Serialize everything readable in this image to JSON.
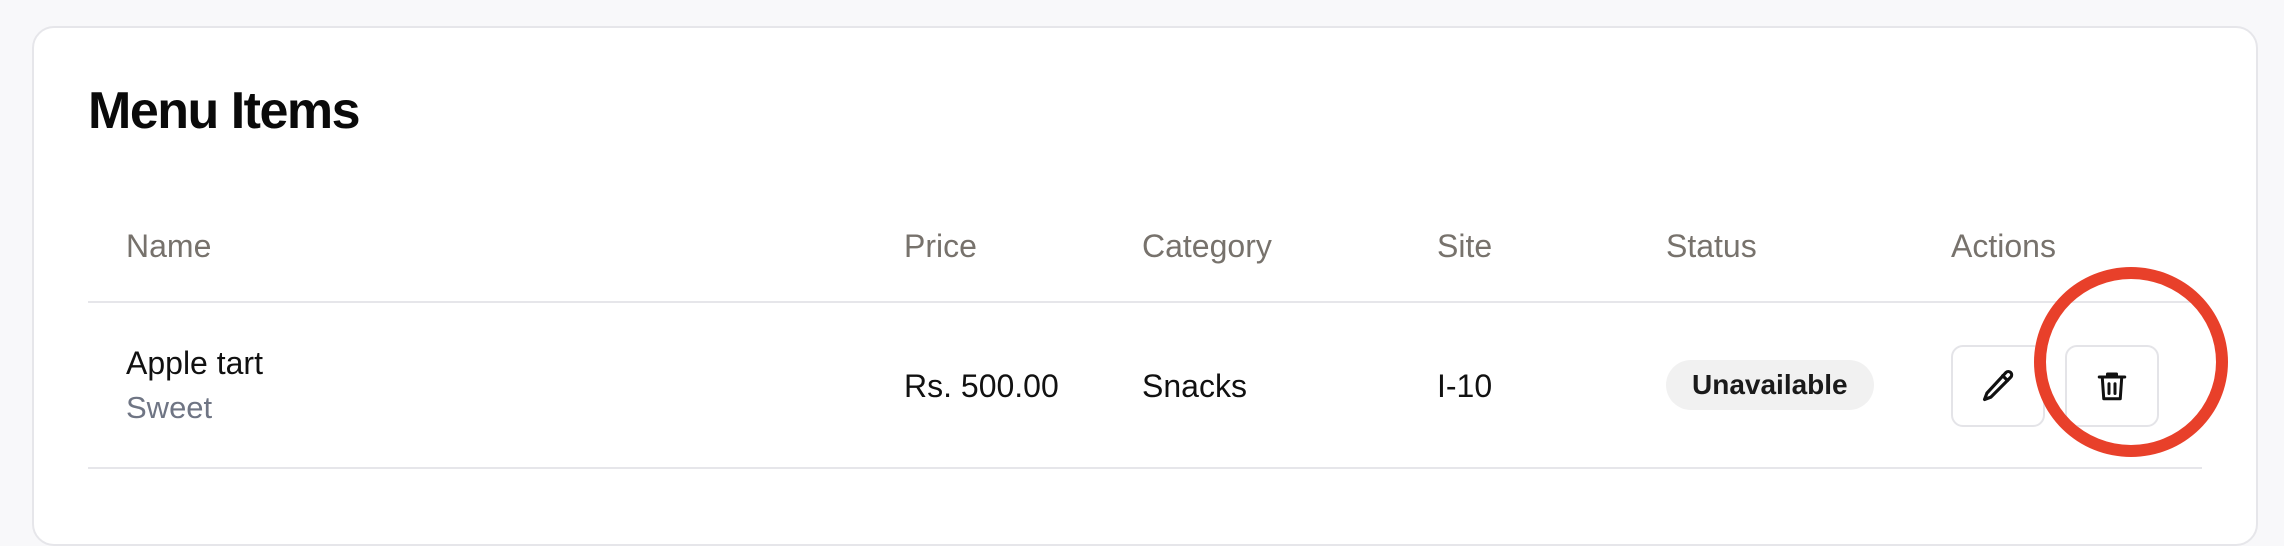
{
  "page": {
    "title": "Menu Items"
  },
  "table": {
    "columns": [
      "Name",
      "Price",
      "Category",
      "Site",
      "Status",
      "Actions"
    ],
    "rows": [
      {
        "name": "Apple tart",
        "subtitle": "Sweet",
        "price": "Rs. 500.00",
        "category": "Snacks",
        "site": "I-10",
        "status": "Unavailable"
      }
    ]
  },
  "icons": {
    "edit": "pencil-icon",
    "delete": "trash-icon"
  },
  "colors": {
    "highlight": "#e8402a",
    "badge_bg": "#f1f1f1",
    "badge_text": "#1a1a1a",
    "header_text": "#77726c",
    "subtitle_text": "#6f7584"
  }
}
